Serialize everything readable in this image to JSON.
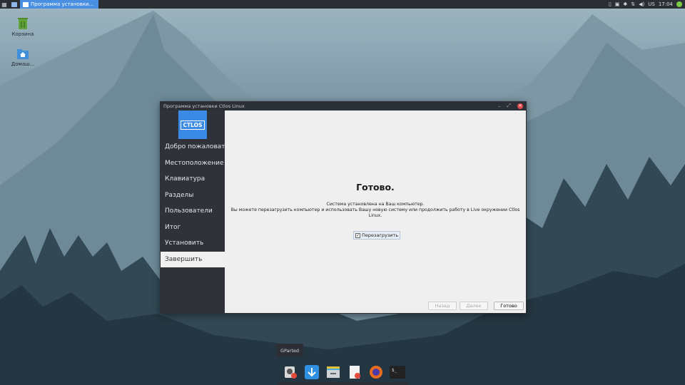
{
  "top_panel": {
    "task_title": "Программа установки...",
    "keyboard_layout": "US",
    "clock": "17:04"
  },
  "desktop": {
    "icons": [
      {
        "label": "Корзина"
      },
      {
        "label": "Домаш..."
      }
    ]
  },
  "window": {
    "title": "Программа установки Ctlos Linux",
    "logo_text": "CTLOS",
    "nav": [
      {
        "label": "Добро пожаловать"
      },
      {
        "label": "Местоположение"
      },
      {
        "label": "Клавиатура"
      },
      {
        "label": "Разделы"
      },
      {
        "label": "Пользователи"
      },
      {
        "label": "Итог"
      },
      {
        "label": "Установить"
      },
      {
        "label": "Завершить"
      }
    ],
    "active_nav": 7,
    "heading": "Готово.",
    "message_line1": "Система установлена на Ваш компьютер.",
    "message_line2": "Вы можете перезагрузить компьютер и использовать Вашу новую систему или продолжить работу в Live окружении Ctlos Linux.",
    "reboot_label": "Перезагрузить",
    "reboot_checked": true,
    "buttons": {
      "back": "Назад",
      "next": "Далее",
      "done": "Готово"
    }
  },
  "dock": {
    "tooltip": "GParted",
    "items": [
      "gparted-icon",
      "download-icon",
      "file-manager-icon",
      "text-editor-icon",
      "firefox-icon",
      "terminal-icon"
    ]
  },
  "colors": {
    "accent": "#4a90e2",
    "logo_bg": "#3b8be6",
    "sidebar_bg": "#2f3339",
    "close_red": "#e0484b"
  }
}
